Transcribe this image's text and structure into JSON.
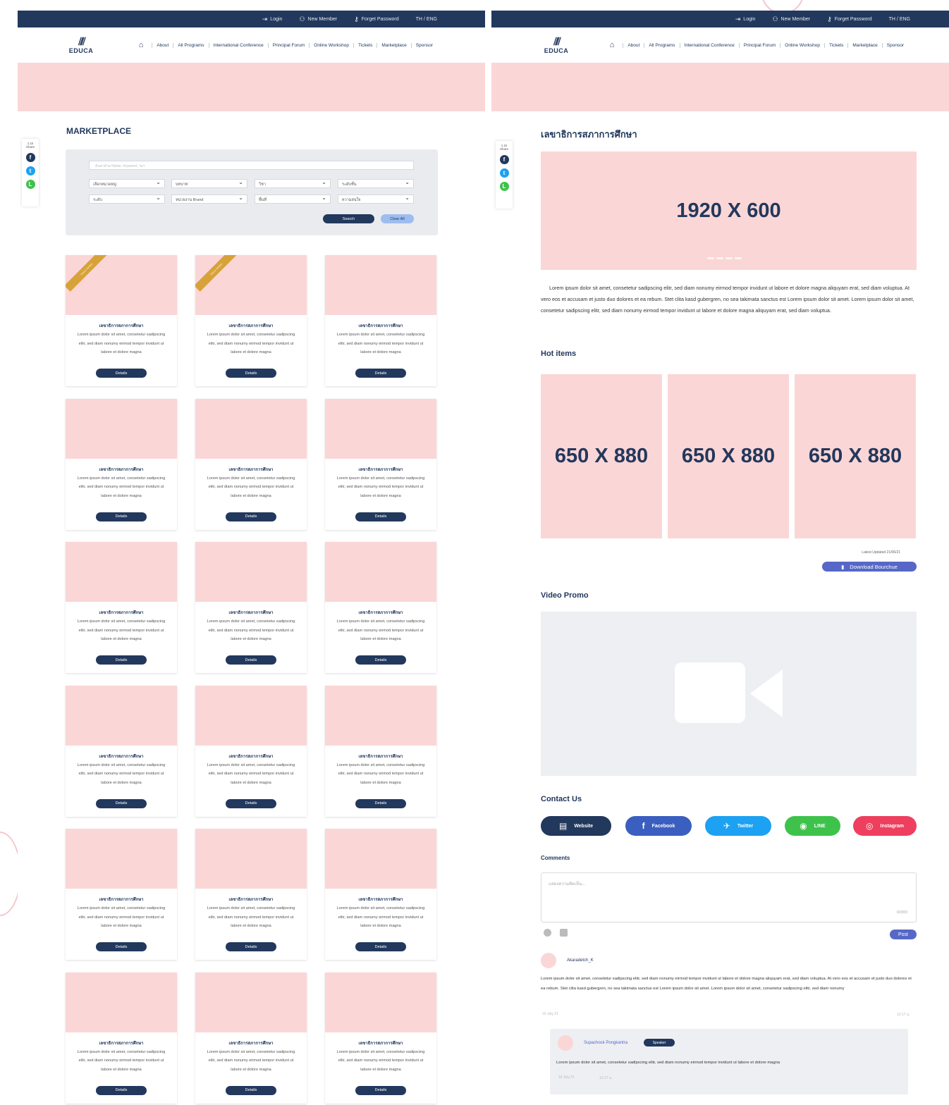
{
  "topbar": {
    "login": "Login",
    "new_member": "New Member",
    "forgot": "Forget Password",
    "lang": "TH / ENG"
  },
  "logo": {
    "word": "EDUCA"
  },
  "nav": [
    "About",
    "All Programs",
    "International Conference",
    "Principal Forum",
    "Online Workshop",
    "Tickets",
    "Marketplace",
    "Sponsor"
  ],
  "share": {
    "count": "1.1k",
    "label": "Share"
  },
  "left": {
    "title": "MARKETPLACE",
    "search_placeholder": "ค้นหาด้วย Name, Keyword, ฯลฯ",
    "selects": [
      "เลือกหมวดหมู่",
      "บทบาท",
      "วิชา",
      "ระดับชั้น",
      "ระดับ",
      "หน่วยงาน Brand",
      "พื้นที่",
      "ความสนใจ"
    ],
    "search_btn": "Search",
    "clear_btn": "Clear All",
    "ribbon": "Educa Verified",
    "card_title": "เลขาธิการสภาการศึกษา",
    "card_desc": "Lorem ipsum dolor sit amet, consetetur sadipscing elitr, sed diam nonumy eirmod tempor invidunt ut labore et dolore magna",
    "card_btn": "Details"
  },
  "right": {
    "title": "เลขาธิการสภาการศึกษา",
    "hero": "1920 X 600",
    "paragraph": "Lorem ipsum dolor sit amet, consetetur sadipscing elitr, sed diam nonumy eirmod tempor invidunt ut labore et dolore magna aliquyam erat, sed diam voluptua. At vero eos et accusam et justo duo dolores et ea rebum. Stet clita kasd gubergren, no sea takimata sanctus est Lorem ipsum dolor sit amet. Lorem ipsum dolor sit amet, consetetur sadipscing elitr, sed diam nonumy eirmod tempor invidunt ut labore et dolore magna aliquyam erat, sed diam voluptua.",
    "hot_title": "Hot items",
    "hot_label": "650 X 880",
    "updated": "Latest Updated 21/06/21",
    "download": "Download Bourchue",
    "video_title": "Video Promo",
    "contact_title": "Contact Us",
    "socials": [
      {
        "label": "Website",
        "color": "#22385d"
      },
      {
        "label": "Facebook",
        "color": "#3b5fc0"
      },
      {
        "label": "Twitter",
        "color": "#1da1f2"
      },
      {
        "label": "LINE",
        "color": "#3ec24c"
      },
      {
        "label": "Instagram",
        "color": "#ee3f5e"
      }
    ],
    "comments_title": "Comments",
    "comment_placeholder": "แสดงความคิดเห็น...",
    "comment_count": "0/2000",
    "post_btn": "Post",
    "c1_user": "Akaradetch_K",
    "c1_text": "Lorem ipsum dolor sit amet, consetetur sadipscing elitr, sed diam nonumy eirmod tempor invidunt ut labore et dolore magna aliquyam erat, sed diam voluptua. At vero eos et accusam et justo duo dolores et ea rebum. Stet clita kasd gubergren, no sea takimata sanctus est Lorem ipsum dolor sit amet. Lorem ipsum dolor sit amet, consetetur sadipscing elitr, sed diam nonumy",
    "c1_date": "16 July 21",
    "c1_time": "12:17 น.",
    "c2_user": "Supachock Pongkantra",
    "c2_badge": "Speaker",
    "c2_text": "Lorem ipsum dolor sit amet, consetetur sadipscing elitr, sed diam nonumy eirmod tempor invidunt ut labore et dolore magna",
    "c2_date": "16 July 21",
    "c2_time": "12:17 น."
  }
}
